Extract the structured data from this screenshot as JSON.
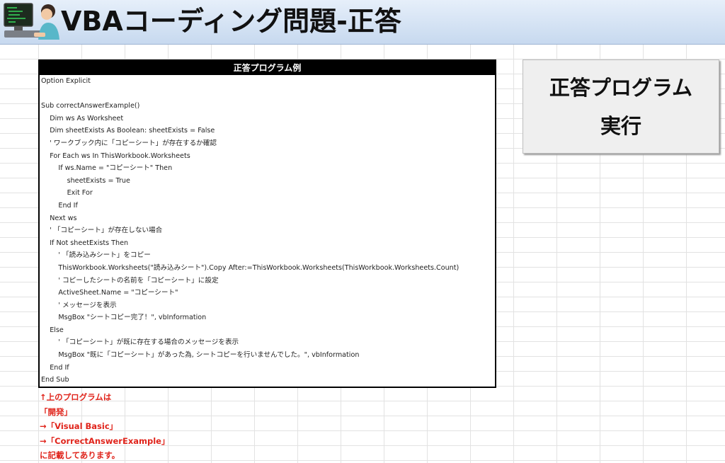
{
  "header": {
    "title": "VBAコーディング問題-正答",
    "avatar_icon": "programmer-at-computer-icon"
  },
  "code_panel": {
    "heading": "正答プログラム例",
    "lines": [
      "Option Explicit",
      "",
      "Sub correctAnswerExample()",
      "    Dim ws As Worksheet",
      "    Dim sheetExists As Boolean: sheetExists = False",
      "    ' ワークブック内に「コピーシート」が存在するか確認",
      "    For Each ws In ThisWorkbook.Worksheets",
      "        If ws.Name = \"コピーシート\" Then",
      "            sheetExists = True",
      "            Exit For",
      "        End If",
      "    Next ws",
      "    ' 「コピーシート」が存在しない場合",
      "    If Not sheetExists Then",
      "        ' 「読み込みシート」をコピー",
      "        ThisWorkbook.Worksheets(\"読み込みシート\").Copy After:=ThisWorkbook.Worksheets(ThisWorkbook.Worksheets.Count)",
      "        ' コピーしたシートの名前を「コピーシート」に設定",
      "        ActiveSheet.Name = \"コピーシート\"",
      "        ' メッセージを表示",
      "        MsgBox \"シートコピー完了！\", vbInformation",
      "    Else",
      "        ' 「コピーシート」が既に存在する場合のメッセージを表示",
      "        MsgBox \"既に「コピーシート」があった為, シートコピーを行いませんでした。\", vbInformation",
      "    End If",
      "End Sub"
    ]
  },
  "run_button": {
    "line1": "正答プログラム",
    "line2": "実行"
  },
  "note": {
    "lines": [
      "↑上のプログラムは",
      "「開発」",
      "→「Visual Basic」",
      "→「CorrectAnswerExample」",
      "に記載してあります。"
    ]
  },
  "colors": {
    "header_gradient_top": "#e6effa",
    "header_gradient_bottom": "#c7d9ef",
    "note_red": "#e0241b",
    "panel_heading_bg": "#000000"
  }
}
